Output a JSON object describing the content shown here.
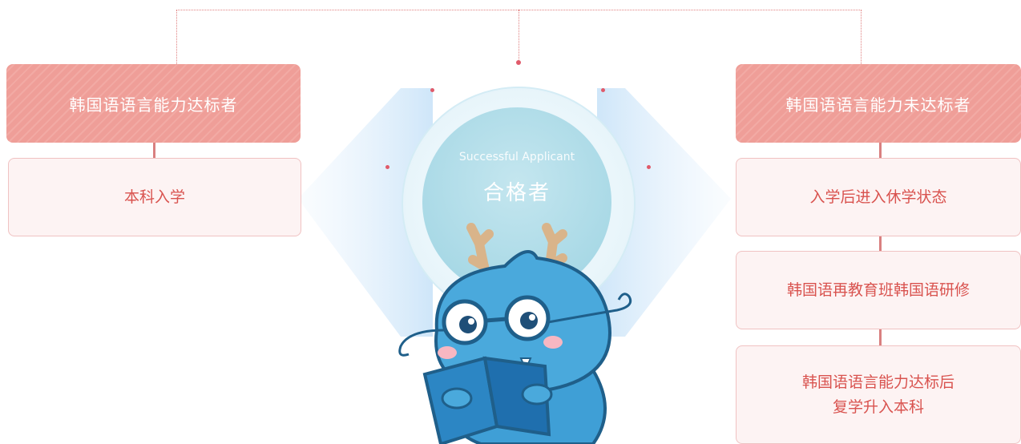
{
  "center": {
    "title_en": "Successful Applicant",
    "title_cn": "合格者"
  },
  "left": {
    "header": "韩国语语言能力达标者",
    "steps": [
      "本科入学"
    ]
  },
  "right": {
    "header": "韩国语语言能力未达标者",
    "steps": [
      "入学后进入休学状态",
      "韩国语再教育班韩国语研修"
    ],
    "final_line1": "韩国语语言能力达标后",
    "final_line2": "复学升入本科"
  },
  "colors": {
    "header_fill": "#ef9e98",
    "step_text": "#d9534f",
    "step_fill": "#fdf3f3",
    "circle_fill": "#a9d9e6",
    "mascot_body": "#4aa9dc"
  },
  "mascot": {
    "icon": "dragon-mascot-reading-icon"
  }
}
